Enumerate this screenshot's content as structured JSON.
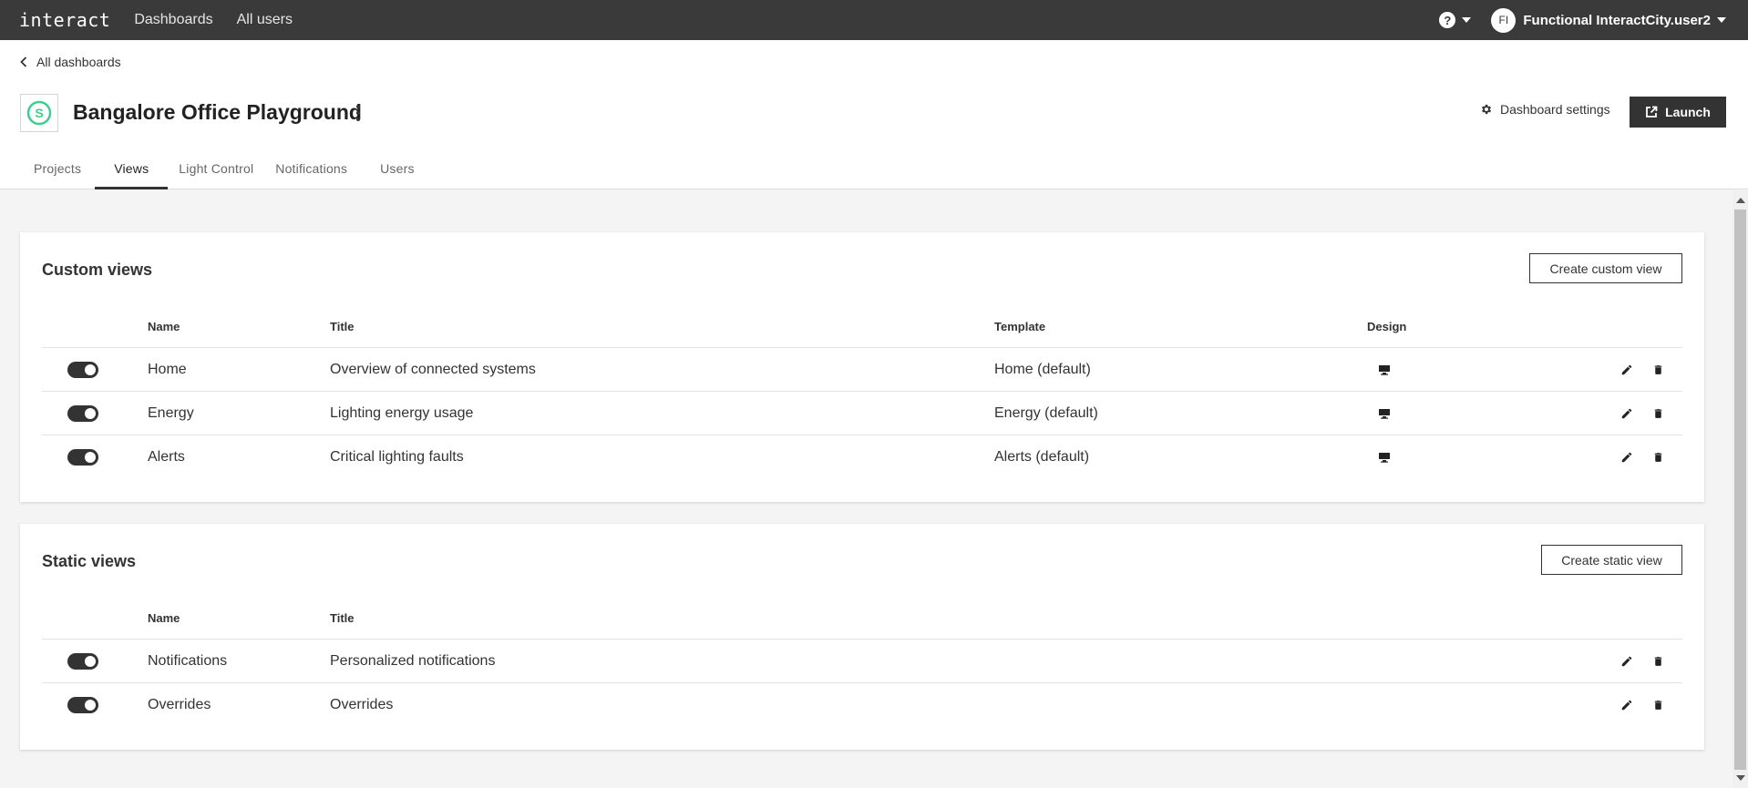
{
  "topbar": {
    "brand": "interact",
    "nav": [
      "Dashboards",
      "All users"
    ],
    "user_initials": "FI",
    "user_name": "Functional InteractCity.user2"
  },
  "header": {
    "back_label": "All dashboards",
    "title": "Bangalore Office Playground",
    "logo_letter": "S",
    "settings_label": "Dashboard settings",
    "launch_label": "Launch",
    "tabs": [
      "Projects",
      "Views",
      "Light Control",
      "Notifications",
      "Users"
    ],
    "active_tab": "Views"
  },
  "custom_views": {
    "title": "Custom views",
    "create_label": "Create custom view",
    "columns": {
      "name": "Name",
      "title": "Title",
      "template": "Template",
      "design": "Design"
    },
    "rows": [
      {
        "name": "Home",
        "title": "Overview of connected systems",
        "template": "Home (default)",
        "enabled": true
      },
      {
        "name": "Energy",
        "title": "Lighting energy usage",
        "template": "Energy (default)",
        "enabled": true
      },
      {
        "name": "Alerts",
        "title": "Critical lighting faults",
        "template": "Alerts (default)",
        "enabled": true
      }
    ]
  },
  "static_views": {
    "title": "Static views",
    "create_label": "Create static view",
    "columns": {
      "name": "Name",
      "title": "Title"
    },
    "rows": [
      {
        "name": "Notifications",
        "title": "Personalized notifications",
        "enabled": true
      },
      {
        "name": "Overrides",
        "title": "Overrides",
        "enabled": true
      }
    ]
  },
  "colors": {
    "topbar": "#3a3a3a",
    "accent_green": "#3ecf8e",
    "dark": "#333333"
  },
  "icons": [
    "chevron-left-icon",
    "help-icon",
    "caret-down-icon",
    "gear-icon",
    "external-link-icon",
    "monitor-icon",
    "pencil-icon",
    "trash-icon",
    "kebab-icon"
  ]
}
